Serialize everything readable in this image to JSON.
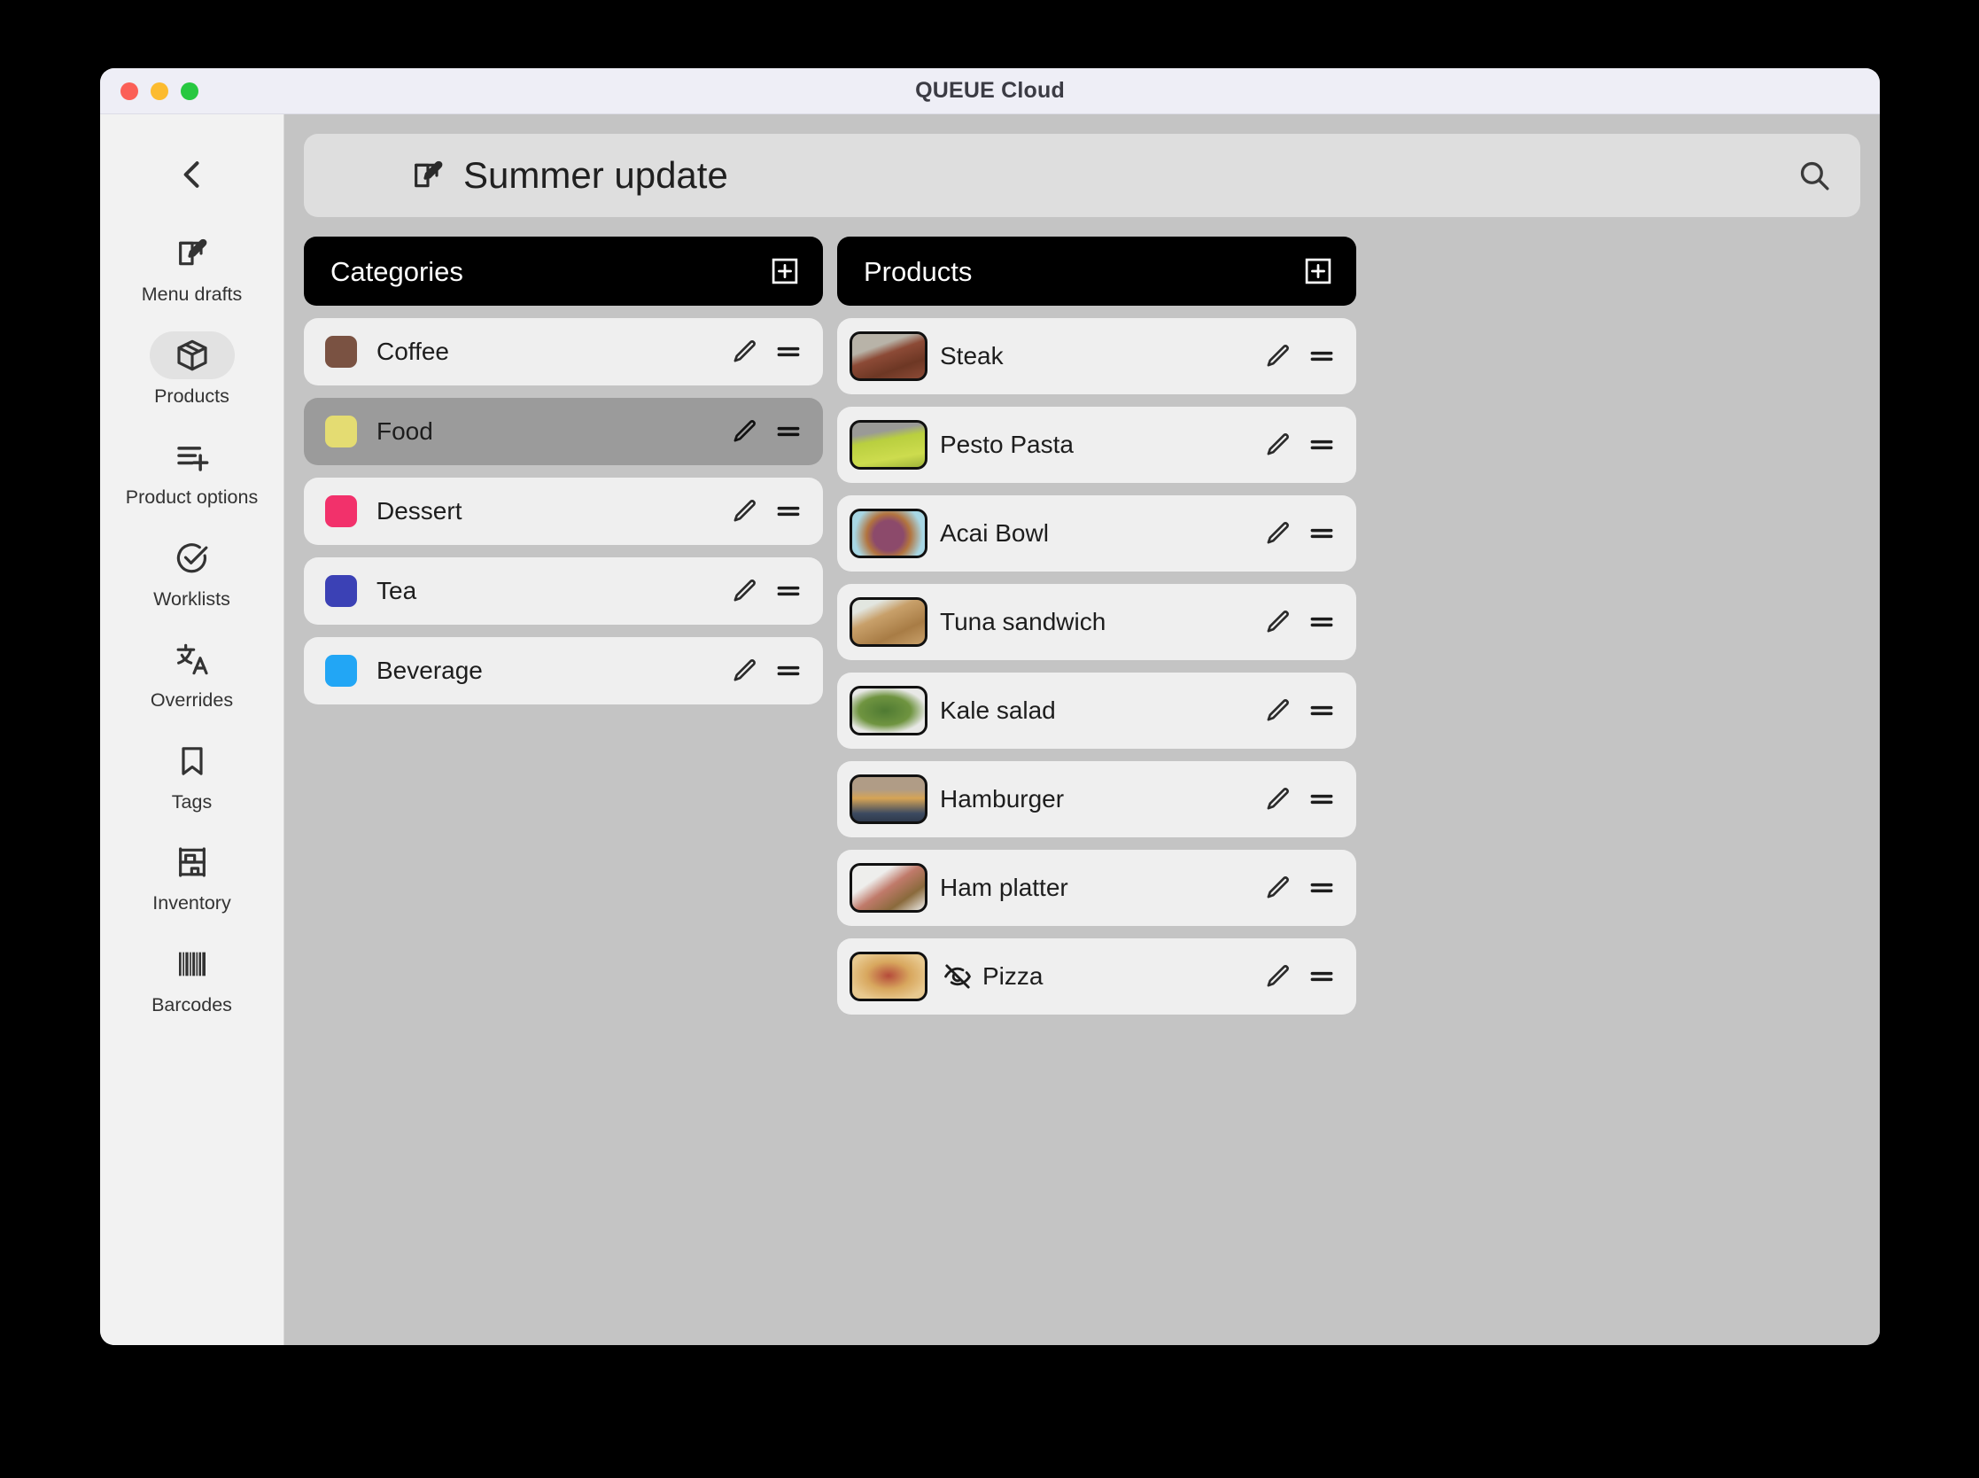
{
  "window": {
    "title": "QUEUE Cloud",
    "traffic_lights": [
      "close-button",
      "minimize-button",
      "maximize-button"
    ]
  },
  "sidebar": {
    "back_icon": "chevron-left-icon",
    "items": [
      {
        "label": "Menu drafts",
        "icon": "edit-square-icon",
        "active": false
      },
      {
        "label": "Products",
        "icon": "box-icon",
        "active": true
      },
      {
        "label": "Product options",
        "icon": "list-add-icon",
        "active": false
      },
      {
        "label": "Worklists",
        "icon": "check-circle-icon",
        "active": false
      },
      {
        "label": "Overrides",
        "icon": "translate-icon",
        "active": false
      },
      {
        "label": "Tags",
        "icon": "bookmark-icon",
        "active": false
      },
      {
        "label": "Inventory",
        "icon": "shelf-icon",
        "active": false
      },
      {
        "label": "Barcodes",
        "icon": "barcode-icon",
        "active": false
      }
    ]
  },
  "header": {
    "draft_icon": "edit-square-icon",
    "draft_title": "Summer update",
    "search_icon": "search-icon"
  },
  "categories_panel": {
    "title": "Categories",
    "add_icon": "plus-square-icon",
    "items": [
      {
        "label": "Coffee",
        "color": "#7a5242",
        "selected": false
      },
      {
        "label": "Food",
        "color": "#e4dc72",
        "selected": true
      },
      {
        "label": "Dessert",
        "color": "#f2316b",
        "selected": false
      },
      {
        "label": "Tea",
        "color": "#3b41b5",
        "selected": false
      },
      {
        "label": "Beverage",
        "color": "#22a6f5",
        "selected": false
      }
    ]
  },
  "products_panel": {
    "title": "Products",
    "add_icon": "plus-square-icon",
    "items": [
      {
        "label": "Steak",
        "hidden": false,
        "thumb": [
          "#b8b3a8",
          "#8c4a36",
          "#6d3724"
        ]
      },
      {
        "label": "Pesto Pasta",
        "hidden": false,
        "thumb": [
          "#9a9a97",
          "#b9cf3f",
          "#cddc4e"
        ]
      },
      {
        "label": "Acai Bowl",
        "hidden": false,
        "thumb": [
          "#a8d7e4",
          "#8c4a6b",
          "#b2743f"
        ]
      },
      {
        "label": "Tuna sandwich",
        "hidden": false,
        "thumb": [
          "#e2e6e0",
          "#c8a06a",
          "#a87c45"
        ]
      },
      {
        "label": "Kale salad",
        "hidden": false,
        "thumb": [
          "#e8e8e6",
          "#4f7a32",
          "#6f9440"
        ]
      },
      {
        "label": "Hamburger",
        "hidden": false,
        "thumb": [
          "#b09c86",
          "#3c4a60",
          "#d6a455"
        ]
      },
      {
        "label": "Ham platter",
        "hidden": false,
        "thumb": [
          "#eeeeec",
          "#c07a6a",
          "#8a6a3c"
        ]
      },
      {
        "label": "Pizza",
        "hidden": true,
        "thumb": [
          "#e8c98f",
          "#d8a75e",
          "#b54b3a"
        ]
      }
    ],
    "hidden_icon": "eye-off-icon",
    "row_icons": {
      "edit": "pencil-icon",
      "drag": "drag-handle-icon"
    }
  }
}
